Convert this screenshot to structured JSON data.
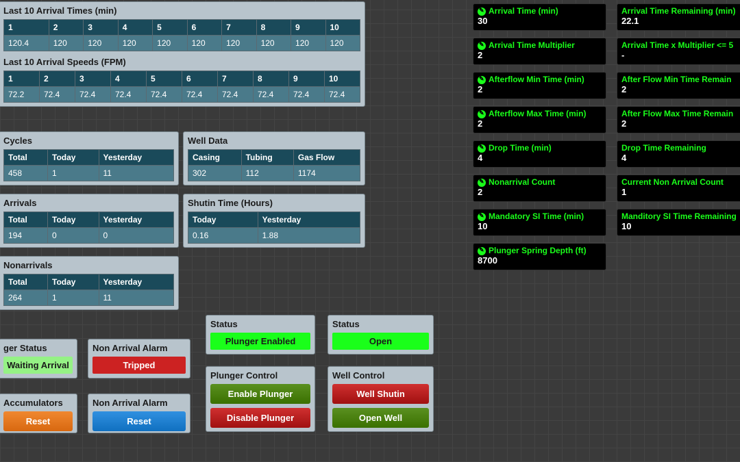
{
  "arrivalTimes": {
    "title": "Last 10 Arrival Times (min)",
    "headers": [
      "1",
      "2",
      "3",
      "4",
      "5",
      "6",
      "7",
      "8",
      "9",
      "10"
    ],
    "values": [
      "120.4",
      "120",
      "120",
      "120",
      "120",
      "120",
      "120",
      "120",
      "120",
      "120"
    ]
  },
  "arrivalSpeeds": {
    "title": "Last 10 Arrival Speeds (FPM)",
    "headers": [
      "1",
      "2",
      "3",
      "4",
      "5",
      "6",
      "7",
      "8",
      "9",
      "10"
    ],
    "values": [
      "72.2",
      "72.4",
      "72.4",
      "72.4",
      "72.4",
      "72.4",
      "72.4",
      "72.4",
      "72.4",
      "72.4"
    ]
  },
  "cycles": {
    "title": "Cycles",
    "h": [
      "Total",
      "Today",
      "Yesterday"
    ],
    "v": [
      "458",
      "1",
      "11"
    ]
  },
  "wellData": {
    "title": "Well Data",
    "h": [
      "Casing",
      "Tubing",
      "Gas Flow"
    ],
    "v": [
      "302",
      "112",
      "1174"
    ]
  },
  "arrivals": {
    "title": "Arrivals",
    "h": [
      "Total",
      "Today",
      "Yesterday"
    ],
    "v": [
      "194",
      "0",
      "0"
    ]
  },
  "shutin": {
    "title": "Shutin Time (Hours)",
    "h": [
      "Today",
      "Yesterday"
    ],
    "v": [
      "0.16",
      "1.88"
    ]
  },
  "nonarrivals": {
    "title": "Nonarrivals",
    "h": [
      "Total",
      "Today",
      "Yesterday"
    ],
    "v": [
      "264",
      "1",
      "11"
    ]
  },
  "plungerStatus": {
    "title": "ger Status",
    "value": "Waiting Arrival"
  },
  "nonArrivalAlarm": {
    "title": "Non Arrival Alarm",
    "value": "Tripped"
  },
  "accumulators": {
    "title": "Accumulators",
    "btn": "Reset"
  },
  "nonArrivalAlarmReset": {
    "title": "Non Arrival Alarm",
    "btn": "Reset"
  },
  "status1": {
    "title": "Status",
    "value": "Plunger Enabled"
  },
  "status2": {
    "title": "Status",
    "value": "Open"
  },
  "plungerControl": {
    "title": "Plunger Control",
    "enable": "Enable Plunger",
    "disable": "Disable Plunger"
  },
  "wellControl": {
    "title": "Well Control",
    "shutin": "Well Shutin",
    "open": "Open Well"
  },
  "params": [
    {
      "label": "Arrival Time (min)",
      "value": "30",
      "edit": true
    },
    {
      "label": "Arrival Time Remaining (min)",
      "value": "22.1",
      "edit": false
    },
    {
      "label": "Arrival Time Multiplier",
      "value": "2",
      "edit": true
    },
    {
      "label": "Arrival Time x Multiplier <= 5",
      "value": "-",
      "edit": false
    },
    {
      "label": "Afterflow Min Time (min)",
      "value": "2",
      "edit": true
    },
    {
      "label": "After Flow Min Time Remain",
      "value": "2",
      "edit": false
    },
    {
      "label": "Afterflow Max Time (min)",
      "value": "2",
      "edit": true
    },
    {
      "label": "After Flow Max Time Remain",
      "value": "2",
      "edit": false
    },
    {
      "label": "Drop Time (min)",
      "value": "4",
      "edit": true
    },
    {
      "label": "Drop Time Remaining",
      "value": "4",
      "edit": false
    },
    {
      "label": "Nonarrival Count",
      "value": "2",
      "edit": true
    },
    {
      "label": "Current Non Arrival Count",
      "value": "1",
      "edit": false
    },
    {
      "label": "Mandatory SI Time (min)",
      "value": "10",
      "edit": true
    },
    {
      "label": "Manditory SI Time Remaining",
      "value": "10",
      "edit": false
    },
    {
      "label": "Plunger Spring Depth (ft)",
      "value": "8700",
      "edit": true
    }
  ]
}
